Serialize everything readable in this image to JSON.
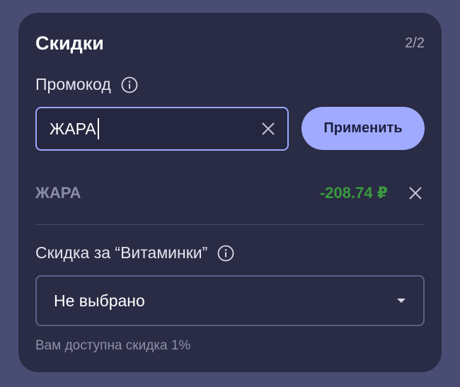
{
  "card": {
    "title": "Скидки",
    "step": "2/2"
  },
  "promo": {
    "label": "Промокод",
    "input_value": "ЖАРА",
    "apply_label": "Применить"
  },
  "applied": {
    "code": "ЖАРА",
    "amount": "-208.74 ₽"
  },
  "vitamins": {
    "label": "Скидка за “Витаминки”",
    "selected": "Не выбрано",
    "hint": "Вам доступна скидка 1%"
  },
  "colors": {
    "background": "#4a4d73",
    "card": "#2a2b45",
    "accent": "#a0abff",
    "discount_green": "#3a9a3f"
  },
  "icons": {
    "info": "info-icon",
    "clear": "close-icon",
    "remove": "close-icon",
    "dropdown": "caret-down-icon"
  }
}
